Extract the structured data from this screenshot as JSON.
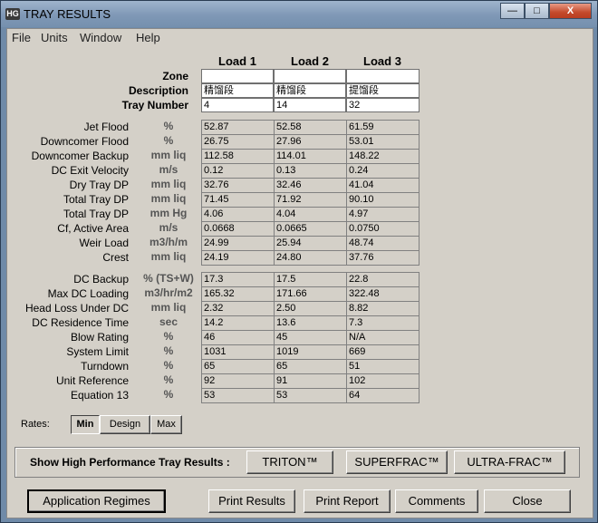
{
  "window": {
    "icon_text": "HG",
    "title": "TRAY RESULTS",
    "minimize": "—",
    "maximize": "□",
    "close": "X"
  },
  "menu": [
    "File",
    "Units",
    "Window",
    "Help"
  ],
  "columns": [
    "Load 1",
    "Load 2",
    "Load 3"
  ],
  "header_rows": [
    {
      "label": "Zone",
      "values": [
        "",
        "",
        ""
      ]
    },
    {
      "label": "Description",
      "values": [
        "精馏段",
        "精馏段",
        "提馏段"
      ]
    },
    {
      "label": "Tray Number",
      "values": [
        "4",
        "14",
        "32"
      ]
    }
  ],
  "group1": [
    {
      "label": "Jet Flood",
      "unit": "%",
      "values": [
        "52.87",
        "52.58",
        "61.59"
      ]
    },
    {
      "label": "Downcomer Flood",
      "unit": "%",
      "values": [
        "26.75",
        "27.96",
        "53.01"
      ]
    },
    {
      "label": "Downcomer Backup",
      "unit": "mm liq",
      "values": [
        "112.58",
        "114.01",
        "148.22"
      ]
    },
    {
      "label": "DC Exit Velocity",
      "unit": "m/s",
      "values": [
        "0.12",
        "0.13",
        "0.24"
      ]
    },
    {
      "label": "Dry Tray DP",
      "unit": "mm liq",
      "values": [
        "32.76",
        "32.46",
        "41.04"
      ]
    },
    {
      "label": "Total Tray DP",
      "unit": "mm liq",
      "values": [
        "71.45",
        "71.92",
        "90.10"
      ]
    },
    {
      "label": "Total Tray DP",
      "unit": "mm Hg",
      "values": [
        "4.06",
        "4.04",
        "4.97"
      ]
    },
    {
      "label": "Cf, Active Area",
      "unit": "m/s",
      "values": [
        "0.0668",
        "0.0665",
        "0.0750"
      ]
    },
    {
      "label": "Weir Load",
      "unit": "m3/h/m",
      "values": [
        "24.99",
        "25.94",
        "48.74"
      ]
    },
    {
      "label": "Crest",
      "unit": "mm liq",
      "values": [
        "24.19",
        "24.80",
        "37.76"
      ]
    }
  ],
  "group2": [
    {
      "label": "DC Backup",
      "unit": "% (TS+W)",
      "values": [
        "17.3",
        "17.5",
        "22.8"
      ]
    },
    {
      "label": "Max DC Loading",
      "unit": "m3/hr/m2",
      "values": [
        "165.32",
        "171.66",
        "322.48"
      ]
    },
    {
      "label": "Head Loss Under DC",
      "unit": "mm liq",
      "values": [
        "2.32",
        "2.50",
        "8.82"
      ]
    },
    {
      "label": "DC Residence Time",
      "unit": "sec",
      "values": [
        "14.2",
        "13.6",
        "7.3"
      ]
    },
    {
      "label": "Blow Rating",
      "unit": "%",
      "values": [
        "46",
        "45",
        "N/A"
      ]
    },
    {
      "label": "System Limit",
      "unit": "%",
      "values": [
        "1031",
        "1019",
        "669"
      ]
    },
    {
      "label": "Turndown",
      "unit": "%",
      "values": [
        "65",
        "65",
        "51"
      ]
    },
    {
      "label": "Unit Reference",
      "unit": "%",
      "values": [
        "92",
        "91",
        "102"
      ]
    },
    {
      "label": "Equation 13",
      "unit": "%",
      "values": [
        "53",
        "53",
        "64"
      ]
    }
  ],
  "rates": {
    "label": "Rates:",
    "options": [
      "Min",
      "Design",
      "Max"
    ],
    "selected": "Min"
  },
  "high_perf": {
    "label": "Show High Performance Tray Results :",
    "buttons": [
      "TRITON™",
      "SUPERFRAC™",
      "ULTRA-FRAC™"
    ]
  },
  "bottom_buttons": {
    "application_regimes": "Application Regimes",
    "print_results": "Print Results",
    "print_report": "Print Report",
    "comments": "Comments",
    "close": "Close"
  }
}
